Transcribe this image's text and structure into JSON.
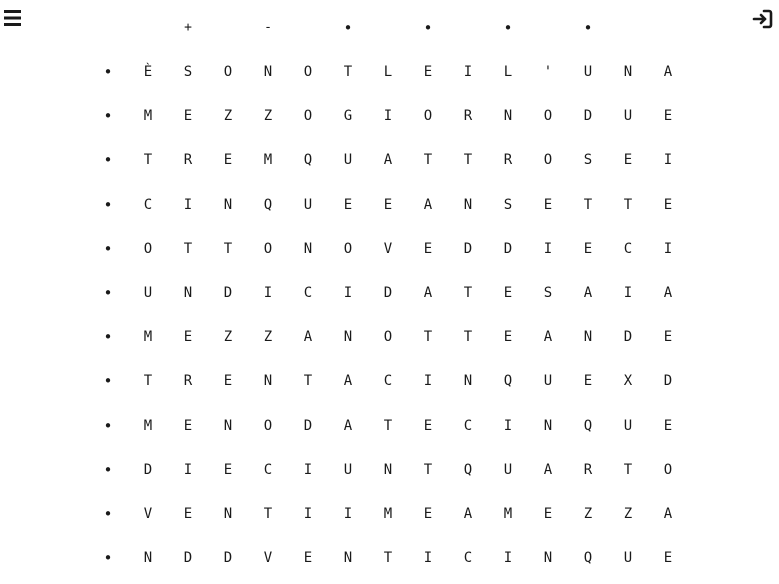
{
  "controls": {
    "plus": "+",
    "minus": "-",
    "minute_dots": [
      "•",
      "•",
      "•",
      "•"
    ]
  },
  "row_dot": "•",
  "grid": [
    [
      "È",
      "S",
      "O",
      "N",
      "O",
      "T",
      "L",
      "E",
      "I",
      "L",
      "'",
      "U",
      "N",
      "A"
    ],
    [
      "M",
      "E",
      "Z",
      "Z",
      "O",
      "G",
      "I",
      "O",
      "R",
      "N",
      "O",
      "D",
      "U",
      "E"
    ],
    [
      "T",
      "R",
      "E",
      "M",
      "Q",
      "U",
      "A",
      "T",
      "T",
      "R",
      "O",
      "S",
      "E",
      "I"
    ],
    [
      "C",
      "I",
      "N",
      "Q",
      "U",
      "E",
      "E",
      "A",
      "N",
      "S",
      "E",
      "T",
      "T",
      "E"
    ],
    [
      "O",
      "T",
      "T",
      "O",
      "N",
      "O",
      "V",
      "E",
      "D",
      "D",
      "I",
      "E",
      "C",
      "I"
    ],
    [
      "U",
      "N",
      "D",
      "I",
      "C",
      "I",
      "D",
      "A",
      "T",
      "E",
      "S",
      "A",
      "I",
      "A"
    ],
    [
      "M",
      "E",
      "Z",
      "Z",
      "A",
      "N",
      "O",
      "T",
      "T",
      "E",
      "A",
      "N",
      "D",
      "E"
    ],
    [
      "T",
      "R",
      "E",
      "N",
      "T",
      "A",
      "C",
      "I",
      "N",
      "Q",
      "U",
      "E",
      "X",
      "D"
    ],
    [
      "M",
      "E",
      "N",
      "O",
      "D",
      "A",
      "T",
      "E",
      "C",
      "I",
      "N",
      "Q",
      "U",
      "E"
    ],
    [
      "D",
      "I",
      "E",
      "C",
      "I",
      "U",
      "N",
      "T",
      "Q",
      "U",
      "A",
      "R",
      "T",
      "O"
    ],
    [
      "V",
      "E",
      "N",
      "T",
      "I",
      "I",
      "M",
      "E",
      "A",
      "M",
      "E",
      "Z",
      "Z",
      "A"
    ],
    [
      "N",
      "D",
      "D",
      "V",
      "E",
      "N",
      "T",
      "I",
      "C",
      "I",
      "N",
      "Q",
      "U",
      "E"
    ]
  ],
  "icons": {
    "menu": "hamburger-menu-icon",
    "login": "login-icon"
  }
}
